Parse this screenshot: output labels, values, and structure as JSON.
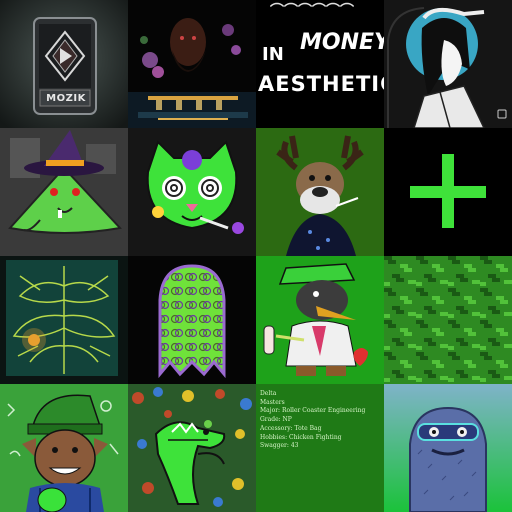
{
  "gallery": {
    "tiles": [
      {
        "id": "mozik-card",
        "label": "MOZIK"
      },
      {
        "id": "bearded-man-lake"
      },
      {
        "id": "in-money-aesthetic",
        "line1": "IN",
        "line2": "MONEY",
        "line3": "AESTHETIC"
      },
      {
        "id": "anime-samurai"
      },
      {
        "id": "green-witch-mouse"
      },
      {
        "id": "psychedelic-cat"
      },
      {
        "id": "smoking-moose"
      },
      {
        "id": "green-plus"
      },
      {
        "id": "fractal-painting"
      },
      {
        "id": "monogram-ghost"
      },
      {
        "id": "green-duck-character"
      },
      {
        "id": "pixel-camo"
      },
      {
        "id": "elf-character"
      },
      {
        "id": "green-creature-painting"
      },
      {
        "id": "trait-card"
      },
      {
        "id": "blue-furry-monster"
      }
    ],
    "trait_card": {
      "name": "Delta",
      "level": "Masters",
      "major": "Major: Roller Coaster Engineering",
      "grade": "Grade: NP",
      "accessory": "Accessory: Tote Bag",
      "hobbies": "Hobbies: Chicken Fighting",
      "swagger": "Swagger: 43"
    },
    "colors": {
      "neon_green": "#39e632",
      "plus_green": "#3fe23a",
      "trait_card_bg": "#1f7a16",
      "monster_bg_top": "#7fb3c9",
      "monster_bg_bottom": "#1bc23a"
    }
  }
}
